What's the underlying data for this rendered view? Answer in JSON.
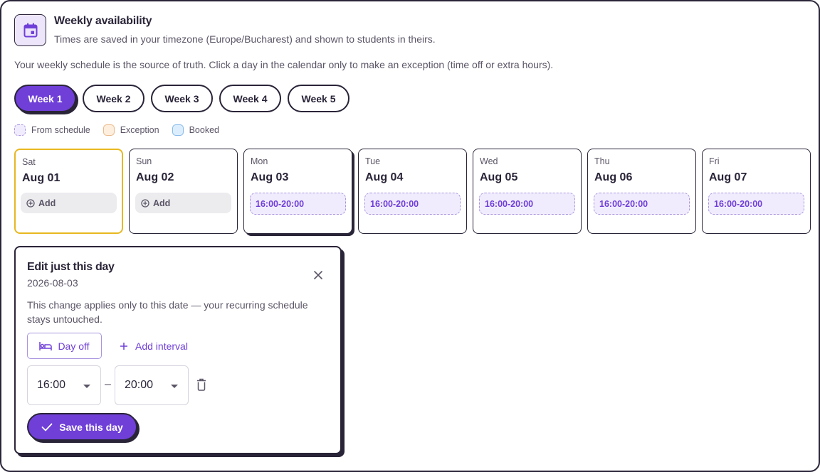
{
  "header": {
    "title": "Weekly availability",
    "subtitle": "Times are saved in your timezone (Europe/Bucharest) and shown to students in theirs.",
    "icon": "calendar-icon"
  },
  "intro": "Your weekly schedule is the source of truth. Click a day in the calendar only to make an exception (time off or extra hours).",
  "weeks": [
    {
      "label": "Week 1",
      "active": true
    },
    {
      "label": "Week 2",
      "active": false
    },
    {
      "label": "Week 3",
      "active": false
    },
    {
      "label": "Week 4",
      "active": false
    },
    {
      "label": "Week 5",
      "active": false
    }
  ],
  "legend": {
    "schedule": "From schedule",
    "exception": "Exception",
    "booked": "Booked"
  },
  "days": [
    {
      "dow": "Sat",
      "date": "Aug 01",
      "action": "Add"
    },
    {
      "dow": "Sun",
      "date": "Aug 02",
      "action": "Add"
    },
    {
      "dow": "Mon",
      "date": "Aug 03",
      "slot": "16:00-20:00"
    },
    {
      "dow": "Tue",
      "date": "Aug 04",
      "slot": "16:00-20:00"
    },
    {
      "dow": "Wed",
      "date": "Aug 05",
      "slot": "16:00-20:00"
    },
    {
      "dow": "Thu",
      "date": "Aug 06",
      "slot": "16:00-20:00"
    },
    {
      "dow": "Fri",
      "date": "Aug 07",
      "slot": "16:00-20:00"
    }
  ],
  "edit": {
    "title": "Edit just this day",
    "date": "2026-08-03",
    "description": "This change applies only to this date — your recurring schedule stays untouched.",
    "day_off_label": "Day off",
    "add_interval_label": "Add interval",
    "interval": {
      "start": "16:00",
      "end": "20:00",
      "separator": "–"
    },
    "save_label": "Save this day"
  },
  "colors": {
    "accent": "#6f3fd8",
    "ink": "#2a2438",
    "today_border": "#e8b820",
    "schedule_fill": "#f1ecfd",
    "exception_fill": "#fdeedd",
    "booked_fill": "#dceefe"
  }
}
